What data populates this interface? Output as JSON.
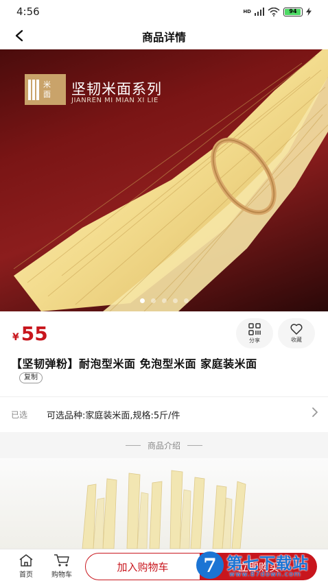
{
  "status_bar": {
    "time": "4:56",
    "net": "HD",
    "battery": "94"
  },
  "navbar": {
    "title": "商品详情"
  },
  "banner": {
    "logo_chars": [
      "米",
      "面"
    ],
    "title": "坚韧米面系列",
    "subtitle": "JIANREN MI MIAN XI LIE",
    "slide_count": 5,
    "active_slide": 0
  },
  "product": {
    "currency": "¥",
    "price": "55",
    "title": "【坚韧弹粉】耐泡型米面 免泡型米面 家庭装米面",
    "copy_label": "复制"
  },
  "actions": {
    "share_label": "分享",
    "favorite_label": "收藏"
  },
  "spec": {
    "label": "已选",
    "value": "可选品种:家庭装米面,规格:5斤/件"
  },
  "intro": {
    "heading": "商品介绍"
  },
  "bottom_bar": {
    "home_label": "首页",
    "cart_label": "购物车",
    "add_to_cart_label": "加入购物车",
    "buy_now_label": "立即购买"
  },
  "watermark": {
    "logo": "7",
    "title": "第七下载站",
    "url": "www.87down.com"
  },
  "colors": {
    "accent": "#c8161d",
    "banner_bg": "#7a1515",
    "watermark": "#1b74d4"
  }
}
